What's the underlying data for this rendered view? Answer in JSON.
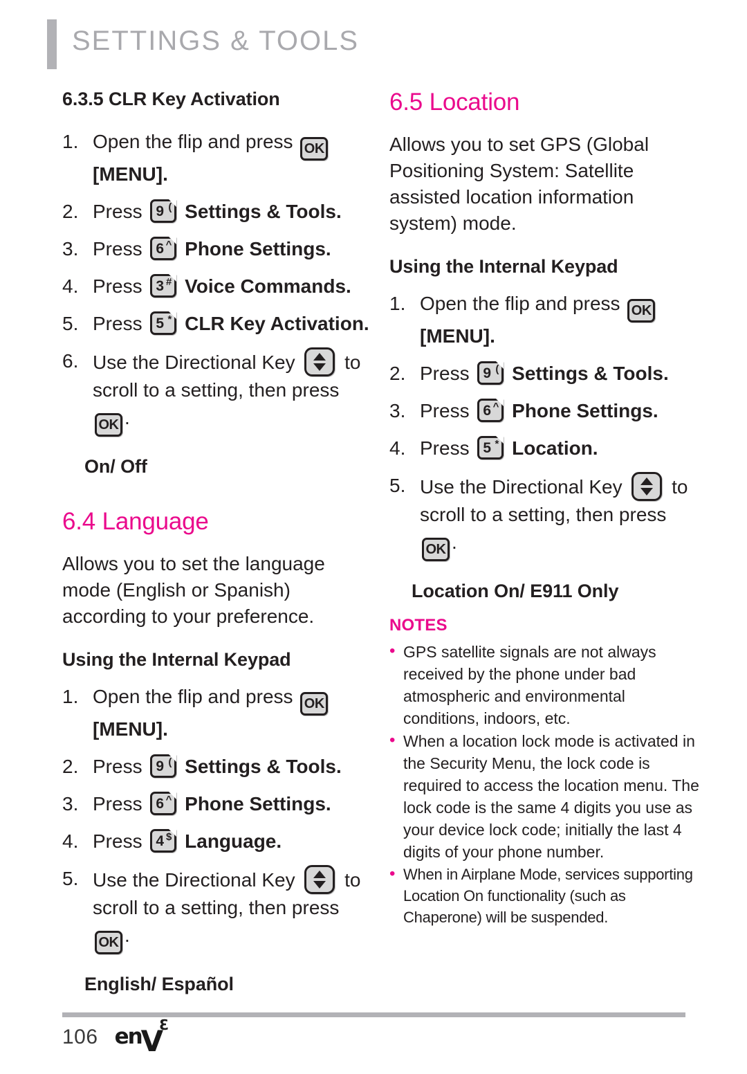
{
  "header": {
    "running_title": "SETTINGS & TOOLS"
  },
  "colors": {
    "accent_magenta": "#EA0A8C",
    "rule_gray": "#B2B2B6",
    "body_text": "#231F20"
  },
  "left_column": {
    "section_clr": {
      "heading": "6.3.5 CLR Key Activation",
      "steps": [
        {
          "num": "1.",
          "pre": "Open the flip and press",
          "key": {
            "type": "ok",
            "label": "OK"
          },
          "post": "",
          "cont_bold": "[MENU]."
        },
        {
          "num": "2.",
          "pre": "Press",
          "key": {
            "type": "digit",
            "digit": "9",
            "sup": "("
          },
          "post": "Settings & Tools."
        },
        {
          "num": "3.",
          "pre": "Press",
          "key": {
            "type": "digit",
            "digit": "6",
            "sup": "^"
          },
          "post": "Phone Settings."
        },
        {
          "num": "4.",
          "pre": "Press",
          "key": {
            "type": "digit",
            "digit": "3",
            "sup": "#"
          },
          "post": "Voice Commands."
        },
        {
          "num": "5.",
          "pre": "Press",
          "key": {
            "type": "digit",
            "digit": "5",
            "sup": "*"
          },
          "post": "CLR Key Activation."
        },
        {
          "num": "6.",
          "pre": "Use the Directional Key",
          "key": {
            "type": "directional"
          },
          "post": "to",
          "cont_pre": "scroll to a setting, then press",
          "cont_key": {
            "type": "ok",
            "label": "OK"
          },
          "cont_post": "."
        }
      ],
      "option_heading": "On/ Off"
    },
    "section_language": {
      "heading": "6.4 Language",
      "intro": "Allows you to set the language mode (English or Spanish) according to your preference.",
      "sub_heading": "Using the Internal Keypad",
      "steps": [
        {
          "num": "1.",
          "pre": "Open the flip and press",
          "key": {
            "type": "ok",
            "label": "OK"
          },
          "post": "",
          "cont_bold": "[MENU]."
        },
        {
          "num": "2.",
          "pre": "Press",
          "key": {
            "type": "digit",
            "digit": "9",
            "sup": "("
          },
          "post": "Settings & Tools."
        },
        {
          "num": "3.",
          "pre": "Press",
          "key": {
            "type": "digit",
            "digit": "6",
            "sup": "^"
          },
          "post": "Phone Settings."
        },
        {
          "num": "4.",
          "pre": "Press",
          "key": {
            "type": "digit",
            "digit": "4",
            "sup": "$"
          },
          "post": "Language."
        },
        {
          "num": "5.",
          "pre": "Use the Directional Key",
          "key": {
            "type": "directional"
          },
          "post": "to",
          "cont_pre": "scroll to a setting, then press",
          "cont_key": {
            "type": "ok",
            "label": "OK"
          },
          "cont_post": "."
        }
      ],
      "option_heading": "English/ Español"
    }
  },
  "right_column": {
    "section_location": {
      "heading": "6.5 Location",
      "intro": "Allows you to set GPS (Global Positioning System: Satellite assisted location information system) mode.",
      "sub_heading": "Using the Internal Keypad",
      "steps": [
        {
          "num": "1.",
          "pre": "Open the flip and press",
          "key": {
            "type": "ok",
            "label": "OK"
          },
          "post": "",
          "cont_bold": "[MENU]."
        },
        {
          "num": "2.",
          "pre": "Press",
          "key": {
            "type": "digit",
            "digit": "9",
            "sup": "("
          },
          "post": "Settings & Tools."
        },
        {
          "num": "3.",
          "pre": "Press",
          "key": {
            "type": "digit",
            "digit": "6",
            "sup": "^"
          },
          "post": "Phone Settings."
        },
        {
          "num": "4.",
          "pre": "Press",
          "key": {
            "type": "digit",
            "digit": "5",
            "sup": "*"
          },
          "post": "Location."
        },
        {
          "num": "5.",
          "pre": "Use the Directional Key",
          "key": {
            "type": "directional"
          },
          "post": "to",
          "cont_pre": "scroll to a setting, then press",
          "cont_key": {
            "type": "ok",
            "label": "OK"
          },
          "cont_post": "."
        }
      ],
      "option_heading": "Location On/ E911 Only",
      "notes_title": "NOTES",
      "notes": [
        "GPS satellite signals are not always received by the phone under bad atmospheric and environmental conditions, indoors, etc.",
        "When a location lock mode is activated in the Security Menu, the lock code is required to access the location menu. The lock code is the same 4 digits you use as your device lock code; initially the last 4 digits of your phone number.",
        "When in Airplane Mode, services supporting Location On functionality (such as Chaperone) will be suspended."
      ]
    }
  },
  "footer": {
    "page_number": "106",
    "brand_en": "en",
    "brand_v": "V",
    "brand_superscript": "3"
  }
}
